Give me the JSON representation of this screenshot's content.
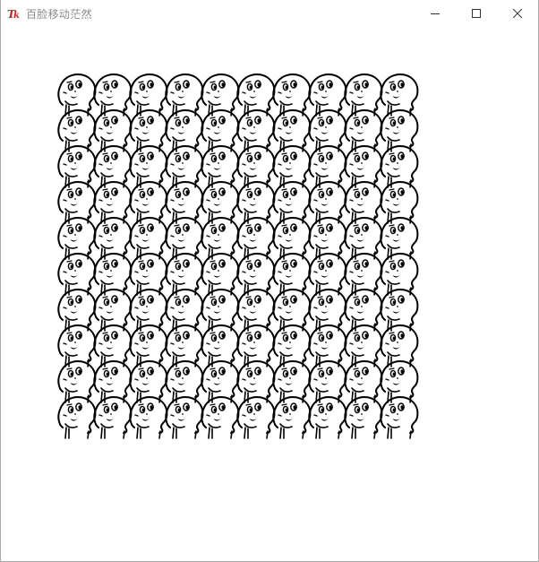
{
  "window": {
    "title": "百脸移动茫然",
    "app_icon": "tk-feather-icon",
    "controls": {
      "minimize": "minimize-icon",
      "maximize": "maximize-icon",
      "close": "close-icon"
    }
  },
  "canvas": {
    "pattern": "face-sprite",
    "rows": 10,
    "columns": 10,
    "background": "#ffffff",
    "stroke": "#000000"
  },
  "colors": {
    "title_text": "#8c8c8c",
    "icon_red": "#cc2222",
    "control_glyph": "#333333"
  }
}
